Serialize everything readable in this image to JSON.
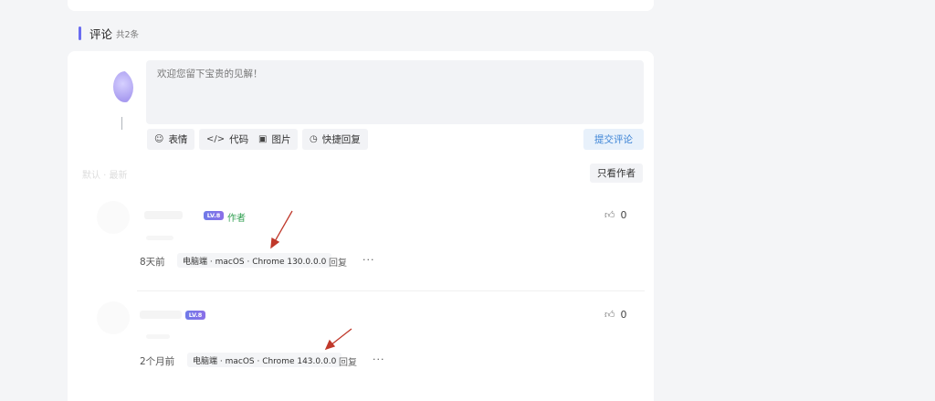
{
  "section": {
    "title": "评论",
    "count": "共2条"
  },
  "editor": {
    "placeholder": "欢迎您留下宝贵的见解！"
  },
  "toolbar": [
    {
      "icon": "emoji-icon",
      "glyph": "☺",
      "label": "表情"
    },
    {
      "icon": "code-icon",
      "glyph": "</>",
      "label": "代码"
    },
    {
      "icon": "image-icon",
      "glyph": "▣",
      "label": "图片"
    },
    {
      "icon": "quick-reply-icon",
      "glyph": "◷",
      "label": "快捷回复"
    }
  ],
  "submit_label": "提交评论",
  "sort_placeholder": "默认 · 最新",
  "only_author_label": "只看作者",
  "comments": [
    {
      "badge": "LV.8",
      "author_tag": "作者",
      "likes": "0",
      "time": "8天前",
      "device": "电脑端 · macOS · Chrome 130.0.0.0",
      "reply": "回复",
      "more": "···"
    },
    {
      "badge": "LV.8",
      "author_tag": "",
      "likes": "0",
      "time": "2个月前",
      "device": "电脑端 · macOS · Chrome 143.0.0.0",
      "reply": "回复",
      "more": "···"
    }
  ],
  "annotation_color": "#c0392b"
}
